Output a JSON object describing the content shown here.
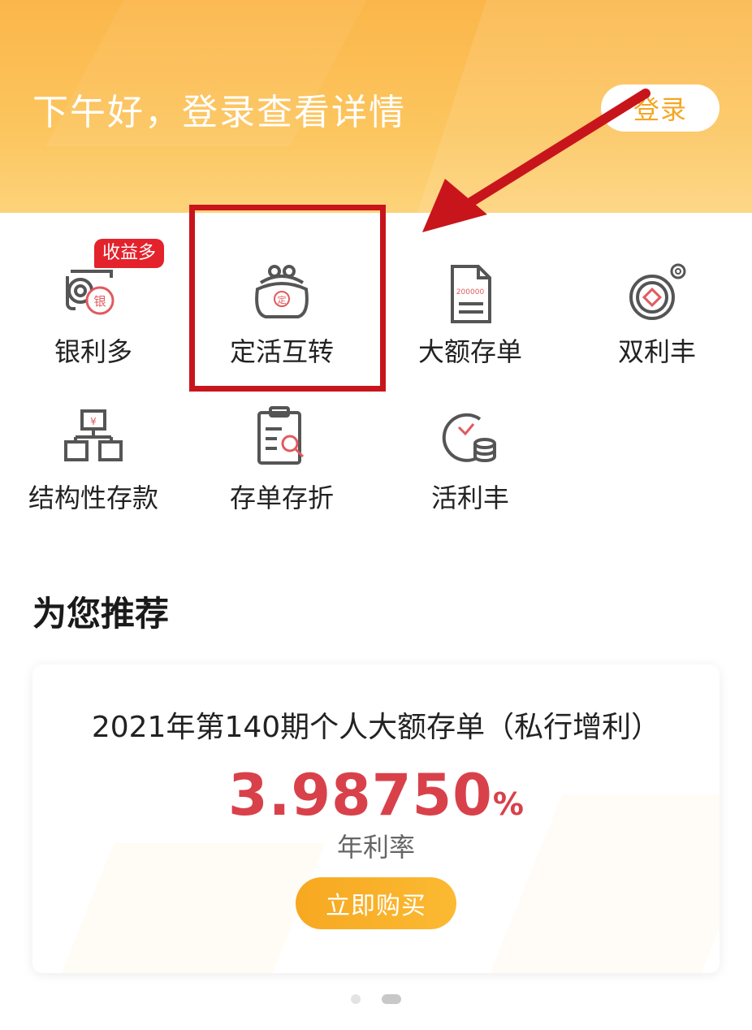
{
  "header": {
    "greeting": "下午好，登录查看详情",
    "login_label": "登录"
  },
  "menu": {
    "items": [
      {
        "label": "银利多",
        "icon": "coins-silver-icon",
        "badge": "收益多"
      },
      {
        "label": "定活互转",
        "icon": "purse-fixed-icon",
        "icon_text": "定"
      },
      {
        "label": "大额存单",
        "icon": "certificate-document-icon",
        "icon_text": "200000"
      },
      {
        "label": "双利丰",
        "icon": "double-coin-icon"
      },
      {
        "label": "结构性存款",
        "icon": "stacked-boxes-icon",
        "icon_text": "¥"
      },
      {
        "label": "存单存折",
        "icon": "clipboard-search-icon"
      },
      {
        "label": "活利丰",
        "icon": "clock-coins-icon"
      }
    ]
  },
  "recommend": {
    "title": "为您推荐",
    "card": {
      "product_name": "2021年第140期个人大额存单（私行增利）",
      "rate_value": "3.98750",
      "rate_unit": "%",
      "rate_label": "年利率",
      "buy_label": "立即购买"
    }
  },
  "carousel": {
    "total": 2,
    "active_index": 2
  },
  "colors": {
    "header_orange": "#fbb64a",
    "accent_gold": "#f5a623",
    "rate_red": "#d9414a",
    "badge_red": "#e3222c",
    "annotation_red": "#c8151c"
  }
}
